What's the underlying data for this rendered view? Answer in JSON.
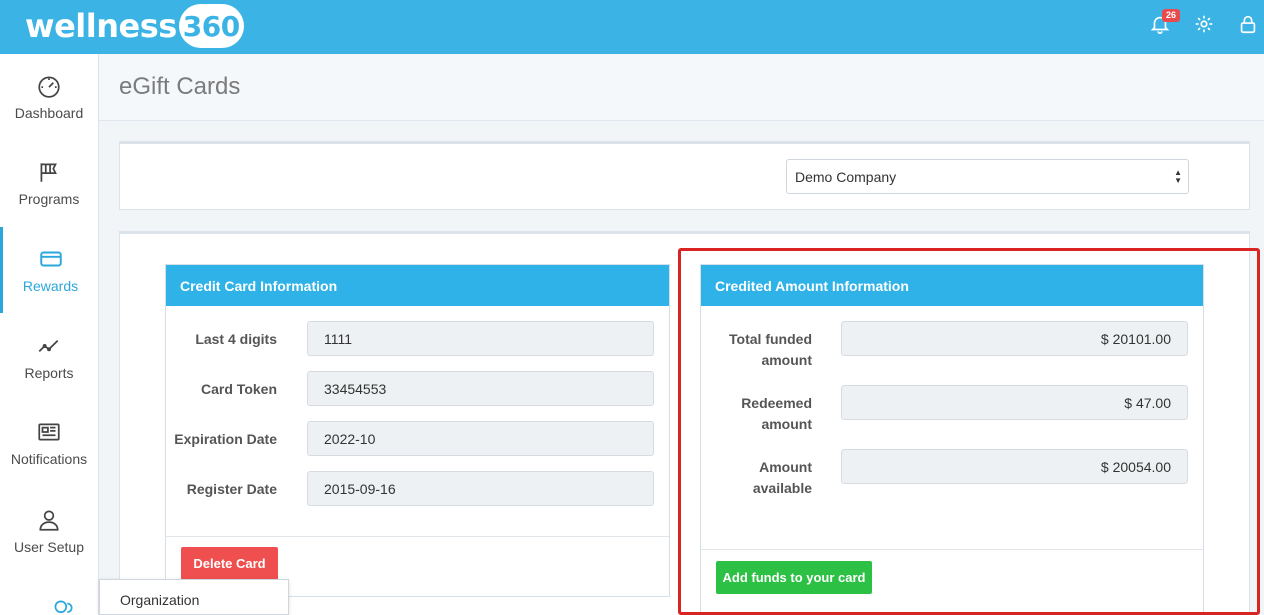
{
  "brand": {
    "text": "wellness",
    "number": "360"
  },
  "topbar": {
    "notification_count": "26"
  },
  "sidebar": {
    "items": [
      {
        "label": "Dashboard"
      },
      {
        "label": "Programs"
      },
      {
        "label": "Rewards"
      },
      {
        "label": "Reports"
      },
      {
        "label": "Notifications"
      },
      {
        "label": "User Setup"
      }
    ],
    "flyout_label": "Organization"
  },
  "page": {
    "title": "eGift Cards"
  },
  "company_select": {
    "value": "Demo Company"
  },
  "credit_card": {
    "title": "Credit Card Information",
    "fields": [
      {
        "label": "Last 4 digits",
        "value": "1111"
      },
      {
        "label": "Card Token",
        "value": "33454553"
      },
      {
        "label": "Expiration Date",
        "value": "2022-10"
      },
      {
        "label": "Register Date",
        "value": "2015-09-16"
      }
    ],
    "delete_label": "Delete Card"
  },
  "credited_amount": {
    "title": "Credited Amount Information",
    "fields": [
      {
        "label_line1": "Total funded",
        "label_line2": "amount",
        "value": "$ 20101.00"
      },
      {
        "label_line1": "Redeemed",
        "label_line2": "amount",
        "value": "$ 47.00"
      },
      {
        "label_line1": "Amount",
        "label_line2": "available",
        "value": "$ 20054.00"
      }
    ],
    "add_funds_label": "Add funds to your card"
  },
  "colors": {
    "topbar": "#3bb4e5",
    "accent": "#2aa7dd",
    "card_header": "#2eb2e7",
    "danger": "#ef4f4f",
    "success": "#2cc144",
    "highlight": "#d92424"
  }
}
